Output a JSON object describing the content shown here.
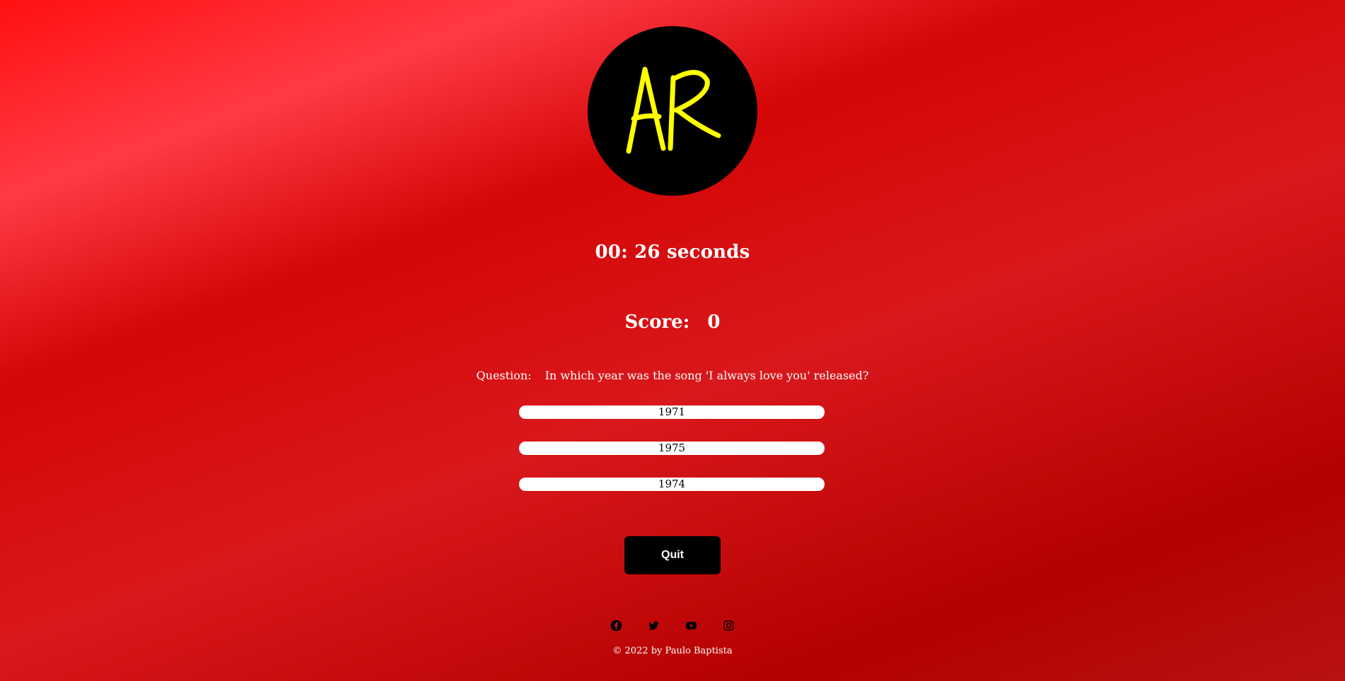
{
  "logo": {
    "text": "AR",
    "background": "#000000",
    "letter_color": "#ffff00"
  },
  "timer": {
    "text": "00: 26 seconds"
  },
  "score": {
    "label": "Score:",
    "value": "0"
  },
  "question": {
    "label": "Question:",
    "text": "In which year was the song 'I always love you' released?"
  },
  "answers": [
    "1971",
    "1975",
    "1974"
  ],
  "quit_button": {
    "label": "Quit"
  },
  "social": [
    {
      "icon": "facebook-icon"
    },
    {
      "icon": "twitter-icon"
    },
    {
      "icon": "youtube-icon"
    },
    {
      "icon": "instagram-icon"
    }
  ],
  "footer": {
    "text": "© 2022 by Paulo Baptista"
  },
  "colors": {
    "background_primary": "#d40606",
    "background_highlight": "#ff3a46",
    "text": "#ffffff",
    "button": "#000000",
    "answer_bg": "#ffffff"
  }
}
